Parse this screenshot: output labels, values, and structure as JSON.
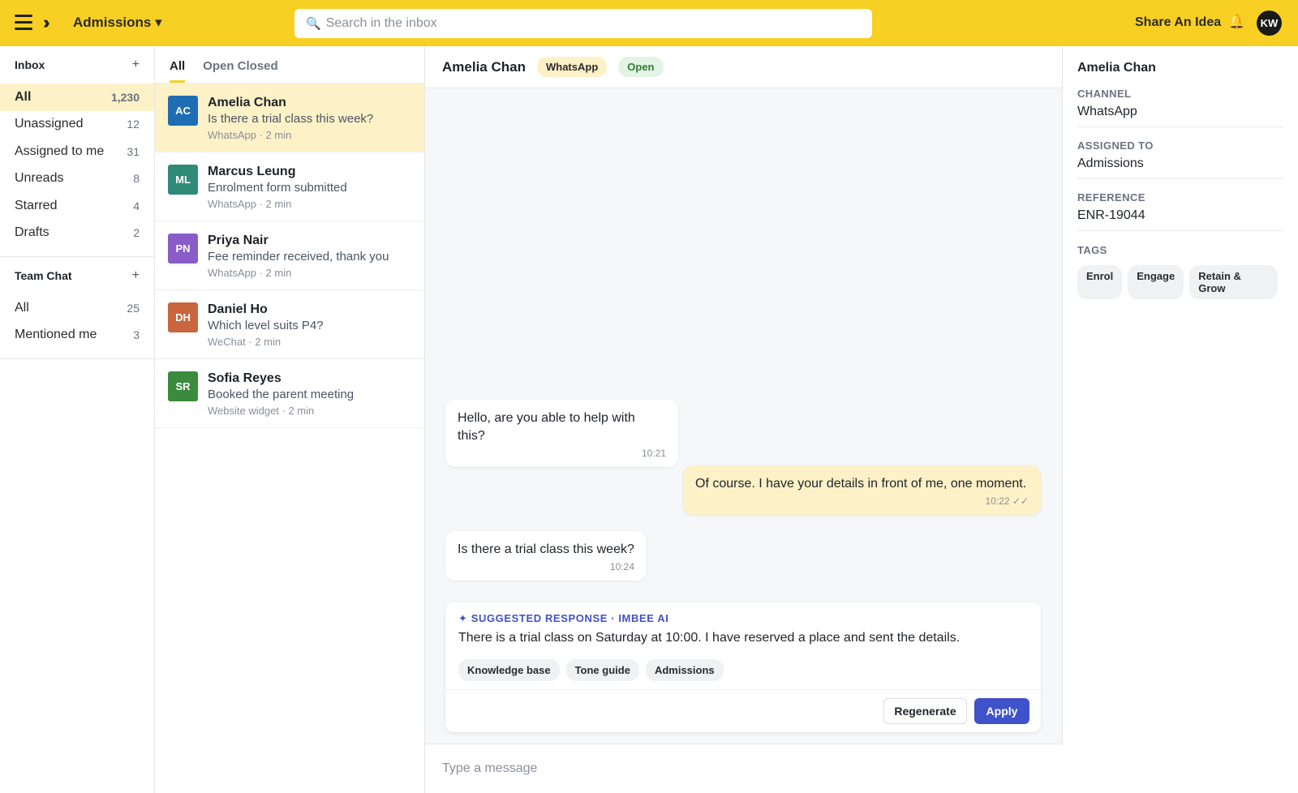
{
  "topbar": {
    "workspace_label": "Admissions ▾",
    "search_placeholder": "Search in the inbox",
    "share_label": "Share An Idea",
    "user_initials": "KW"
  },
  "sidebar": {
    "inbox_title": "Inbox",
    "inbox_items": [
      {
        "label": "All",
        "count": "1,230"
      },
      {
        "label": "Unassigned",
        "count": "12"
      },
      {
        "label": "Assigned to me",
        "count": "31"
      },
      {
        "label": "Unreads",
        "count": "8"
      },
      {
        "label": "Starred",
        "count": "4"
      },
      {
        "label": "Drafts",
        "count": "2"
      }
    ],
    "team_title": "Team Chat",
    "team_items": [
      {
        "label": "All",
        "count": "25"
      },
      {
        "label": "Mentioned me",
        "count": "3"
      }
    ],
    "add_glyph": "+"
  },
  "convlist": {
    "tabs": [
      "All",
      "Open Closed"
    ],
    "conversations": [
      {
        "initials": "AC",
        "name": "Amelia Chan",
        "preview": "Is there a trial class this week?",
        "meta": "WhatsApp · 2 min",
        "color": "#1f6db3"
      },
      {
        "initials": "ML",
        "name": "Marcus Leung",
        "preview": "Enrolment form submitted",
        "meta": "WhatsApp · 2 min",
        "color": "#2f8a78"
      },
      {
        "initials": "PN",
        "name": "Priya Nair",
        "preview": "Fee reminder received, thank you",
        "meta": "WhatsApp · 2 min",
        "color": "#8a5cc7"
      },
      {
        "initials": "DH",
        "name": "Daniel Ho",
        "preview": "Which level suits P4?",
        "meta": "WeChat · 2 min",
        "color": "#c9663d"
      },
      {
        "initials": "SR",
        "name": "Sofia Reyes",
        "preview": "Booked the parent meeting",
        "meta": "Website widget · 2 min",
        "color": "#3b8a3e"
      }
    ]
  },
  "chat": {
    "contact_name": "Amelia Chan",
    "channel_pill": "WhatsApp",
    "status_pill": "Open",
    "messages": [
      {
        "text": "Hello, are you able to help with this?",
        "time": "10:21"
      },
      {
        "text": "Of course. I have your details in front of me, one moment.",
        "time": "10:22 ✓✓"
      },
      {
        "text": "Is there a trial class this week?",
        "time": "10:24"
      }
    ],
    "suggestion": {
      "label": "✦ SUGGESTED RESPONSE · IMBEE AI",
      "text": "There is a trial class on Saturday at 10:00. I have reserved a place and sent the details.",
      "sources": [
        "Knowledge base",
        "Tone guide",
        "Admissions"
      ],
      "regenerate_label": "Regenerate",
      "apply_label": "Apply"
    },
    "composer_placeholder": "Type a message"
  },
  "details": {
    "name": "Amelia Chan",
    "fields": [
      {
        "label": "CHANNEL",
        "value": "WhatsApp"
      },
      {
        "label": "ASSIGNED TO",
        "value": "Admissions"
      },
      {
        "label": "REFERENCE",
        "value": "ENR-19044"
      }
    ],
    "tags_label": "TAGS",
    "tags": [
      "Enrol",
      "Engage",
      "Retain & Grow"
    ]
  },
  "colors": {
    "brand_yellow": "#f8cf23",
    "active_row": "#fdf1c7",
    "ai_accent": "#4052c9"
  }
}
